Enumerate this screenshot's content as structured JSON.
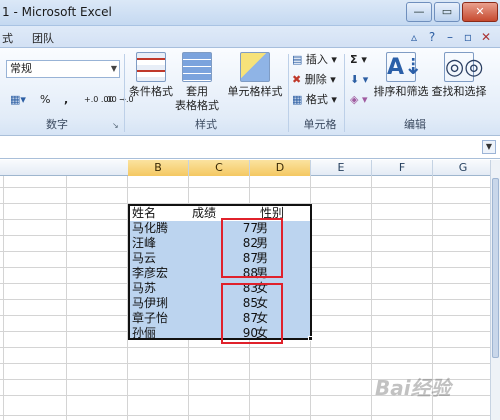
{
  "window": {
    "title": "1 - Microsoft Excel"
  },
  "tabs": [
    "式",
    "团队"
  ],
  "ribbon": {
    "number": {
      "format_value": "常规",
      "percent": "%",
      "comma": ",",
      "inc_decimal": "+.0 .00",
      "dec_decimal": ".00 →.0",
      "label": "数字"
    },
    "styles": {
      "conditional": "条件格式",
      "table_top": "套用",
      "table_bottom": "表格格式",
      "cell_style": "单元格样式",
      "label": "样式"
    },
    "cells": {
      "insert": "插入",
      "delete": "删除",
      "format": "格式",
      "label": "单元格"
    },
    "editing": {
      "sort_filter": "排序和筛选",
      "find_select": "查找和选择",
      "label": "编辑"
    }
  },
  "columns": [
    "B",
    "C",
    "D",
    "E",
    "F",
    "G"
  ],
  "sheet": {
    "headers": [
      "姓名",
      "成绩",
      "性别"
    ],
    "rows": [
      {
        "name": "马化腾",
        "score": "77",
        "gender": "男"
      },
      {
        "name": "汪峰",
        "score": "82",
        "gender": "男"
      },
      {
        "name": "马云",
        "score": "87",
        "gender": "男"
      },
      {
        "name": "李彦宏",
        "score": "88",
        "gender": "男"
      },
      {
        "name": "马苏",
        "score": "83",
        "gender": "女"
      },
      {
        "name": "马伊琍",
        "score": "85",
        "gender": "女"
      },
      {
        "name": "章子怡",
        "score": "87",
        "gender": "女"
      },
      {
        "name": "孙俪",
        "score": "90",
        "gender": "女"
      }
    ]
  },
  "watermark": "Bai经验",
  "colors": {
    "selection": "#bcd4ef",
    "highlight_box": "#e0212b",
    "selected_column_header": "#f4c862"
  }
}
